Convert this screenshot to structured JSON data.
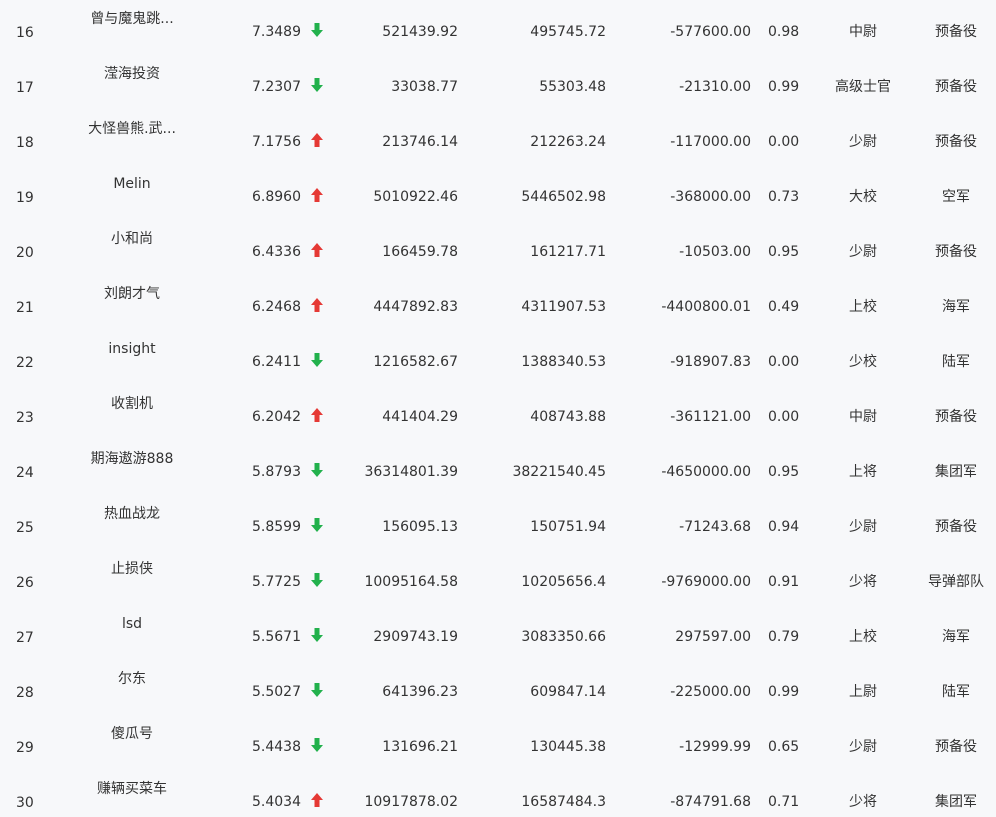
{
  "colors": {
    "up": "#e53935",
    "down": "#22b14c",
    "text": "#333333",
    "background": "#f7f8fa"
  },
  "rows": [
    {
      "rank": "16",
      "name": "曾与魔鬼跳...",
      "score": "7.3489",
      "trend": "down",
      "trend_icon": "arrow-down-icon",
      "v1": "521439.92",
      "v2": "495745.72",
      "v3": "-577600.00",
      "ratio": "0.98",
      "military_rank": "中尉",
      "unit": "预备役"
    },
    {
      "rank": "17",
      "name": "滢海投资",
      "score": "7.2307",
      "trend": "down",
      "trend_icon": "arrow-down-icon",
      "v1": "33038.77",
      "v2": "55303.48",
      "v3": "-21310.00",
      "ratio": "0.99",
      "military_rank": "高级士官",
      "unit": "预备役"
    },
    {
      "rank": "18",
      "name": "大怪兽熊.武...",
      "score": "7.1756",
      "trend": "up",
      "trend_icon": "arrow-up-icon",
      "v1": "213746.14",
      "v2": "212263.24",
      "v3": "-117000.00",
      "ratio": "0.00",
      "military_rank": "少尉",
      "unit": "预备役"
    },
    {
      "rank": "19",
      "name": "Melin",
      "score": "6.8960",
      "trend": "up",
      "trend_icon": "arrow-up-icon",
      "v1": "5010922.46",
      "v2": "5446502.98",
      "v3": "-368000.00",
      "ratio": "0.73",
      "military_rank": "大校",
      "unit": "空军"
    },
    {
      "rank": "20",
      "name": "小和尚",
      "score": "6.4336",
      "trend": "up",
      "trend_icon": "arrow-up-icon",
      "v1": "166459.78",
      "v2": "161217.71",
      "v3": "-10503.00",
      "ratio": "0.95",
      "military_rank": "少尉",
      "unit": "预备役"
    },
    {
      "rank": "21",
      "name": "刘朗才气",
      "score": "6.2468",
      "trend": "up",
      "trend_icon": "arrow-up-icon",
      "v1": "4447892.83",
      "v2": "4311907.53",
      "v3": "-4400800.01",
      "ratio": "0.49",
      "military_rank": "上校",
      "unit": "海军"
    },
    {
      "rank": "22",
      "name": "insight",
      "score": "6.2411",
      "trend": "down",
      "trend_icon": "arrow-down-icon",
      "v1": "1216582.67",
      "v2": "1388340.53",
      "v3": "-918907.83",
      "ratio": "0.00",
      "military_rank": "少校",
      "unit": "陆军"
    },
    {
      "rank": "23",
      "name": "收割机",
      "score": "6.2042",
      "trend": "up",
      "trend_icon": "arrow-up-icon",
      "v1": "441404.29",
      "v2": "408743.88",
      "v3": "-361121.00",
      "ratio": "0.00",
      "military_rank": "中尉",
      "unit": "预备役"
    },
    {
      "rank": "24",
      "name": "期海遨游888",
      "score": "5.8793",
      "trend": "down",
      "trend_icon": "arrow-down-icon",
      "v1": "36314801.39",
      "v2": "38221540.45",
      "v3": "-4650000.00",
      "ratio": "0.95",
      "military_rank": "上将",
      "unit": "集团军"
    },
    {
      "rank": "25",
      "name": "热血战龙",
      "score": "5.8599",
      "trend": "down",
      "trend_icon": "arrow-down-icon",
      "v1": "156095.13",
      "v2": "150751.94",
      "v3": "-71243.68",
      "ratio": "0.94",
      "military_rank": "少尉",
      "unit": "预备役"
    },
    {
      "rank": "26",
      "name": "止损侠",
      "score": "5.7725",
      "trend": "down",
      "trend_icon": "arrow-down-icon",
      "v1": "10095164.58",
      "v2": "10205656.4",
      "v3": "-9769000.00",
      "ratio": "0.91",
      "military_rank": "少将",
      "unit": "导弹部队"
    },
    {
      "rank": "27",
      "name": "lsd",
      "score": "5.5671",
      "trend": "down",
      "trend_icon": "arrow-down-icon",
      "v1": "2909743.19",
      "v2": "3083350.66",
      "v3": "297597.00",
      "ratio": "0.79",
      "military_rank": "上校",
      "unit": "海军"
    },
    {
      "rank": "28",
      "name": "尔东",
      "score": "5.5027",
      "trend": "down",
      "trend_icon": "arrow-down-icon",
      "v1": "641396.23",
      "v2": "609847.14",
      "v3": "-225000.00",
      "ratio": "0.99",
      "military_rank": "上尉",
      "unit": "陆军"
    },
    {
      "rank": "29",
      "name": "傻瓜号",
      "score": "5.4438",
      "trend": "down",
      "trend_icon": "arrow-down-icon",
      "v1": "131696.21",
      "v2": "130445.38",
      "v3": "-12999.99",
      "ratio": "0.65",
      "military_rank": "少尉",
      "unit": "预备役"
    },
    {
      "rank": "30",
      "name": "赚辆买菜车",
      "score": "5.4034",
      "trend": "up",
      "trend_icon": "arrow-up-icon",
      "v1": "10917878.02",
      "v2": "16587484.3",
      "v3": "-874791.68",
      "ratio": "0.71",
      "military_rank": "少将",
      "unit": "集团军"
    }
  ]
}
